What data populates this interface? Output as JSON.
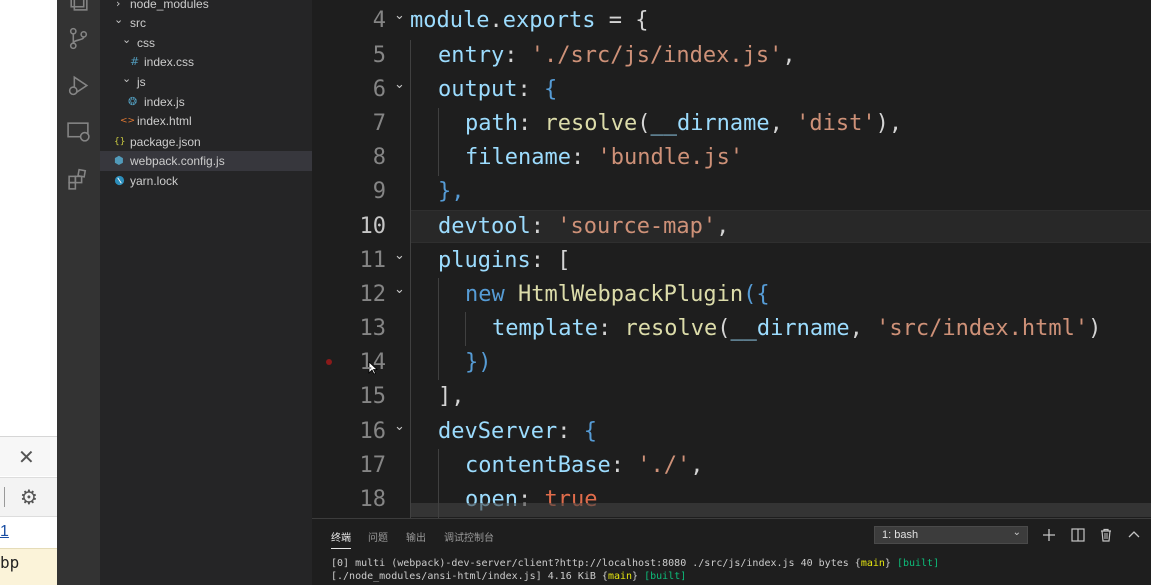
{
  "browser": {
    "close_glyph": "✕",
    "gear_glyph": "⚙",
    "link_text": "1",
    "source_snippet": "bp"
  },
  "activity_bar": {
    "icons": [
      "explorer-icon",
      "source-control-icon",
      "debug-icon",
      "remote-explorer-icon",
      "extensions-icon"
    ]
  },
  "explorer": {
    "items": [
      {
        "label": "node_modules",
        "icon": "chevron-right",
        "depth": 0
      },
      {
        "label": "src",
        "icon": "chevron-down",
        "depth": 0
      },
      {
        "label": "css",
        "icon": "chevron-down",
        "depth": 1
      },
      {
        "label": "index.css",
        "icon": "css-file-icon",
        "depth": 2
      },
      {
        "label": "js",
        "icon": "chevron-down",
        "depth": 1
      },
      {
        "label": "index.js",
        "icon": "js-file-icon",
        "depth": 2
      },
      {
        "label": "index.html",
        "icon": "html-file-icon",
        "depth": 1
      },
      {
        "label": "package.json",
        "icon": "json-file-icon",
        "depth": 0
      },
      {
        "label": "webpack.config.js",
        "icon": "webpack-file-icon",
        "depth": 0,
        "selected": true
      },
      {
        "label": "yarn.lock",
        "icon": "yarn-file-icon",
        "depth": 0
      }
    ],
    "glyphs": {
      "chevron_right": "›",
      "chevron_down": "⌄",
      "css": "#",
      "js": "❂",
      "html": "<>",
      "json": "{}",
      "webpack": "⬢",
      "yarn": "🧶"
    }
  },
  "editor": {
    "line_numbers": [
      "4",
      "5",
      "6",
      "7",
      "8",
      "9",
      "10",
      "11",
      "12",
      "13",
      "14",
      "15",
      "16",
      "17",
      "18"
    ],
    "current_line": "10",
    "breakpoint_line": "14",
    "fold_lines": [
      "4",
      "6",
      "11",
      "12",
      "16"
    ],
    "fold_glyph": "⌄",
    "lines": {
      "l4": {
        "a": "module",
        "b": ".",
        "c": "exports",
        "d": " = {"
      },
      "l5": {
        "a": "entry",
        "b": ": ",
        "c": "'./src/js/index.js'",
        "d": ","
      },
      "l6": {
        "a": "output",
        "b": ": ",
        "c": "{"
      },
      "l7": {
        "a": "path",
        "b": ": ",
        "c": "resolve",
        "d": "(",
        "e": "__dirname",
        "f": ", ",
        "g": "'dist'",
        "h": "),"
      },
      "l8": {
        "a": "filename",
        "b": ": ",
        "c": "'bundle.js'"
      },
      "l9": {
        "a": "},"
      },
      "l10": {
        "a": "devtool",
        "b": ": ",
        "c": "'source-map'",
        "d": ","
      },
      "l11": {
        "a": "plugins",
        "b": ": ["
      },
      "l12": {
        "a": "new ",
        "b": "HtmlWebpackPlugin",
        "c": "({"
      },
      "l13": {
        "a": "template",
        "b": ": ",
        "c": "resolve",
        "d": "(",
        "e": "__dirname",
        "f": ", ",
        "g": "'src/index.html'",
        "h": ")"
      },
      "l14": {
        "a": "})"
      },
      "l15": {
        "a": "],"
      },
      "l16": {
        "a": "devServer",
        "b": ": ",
        "c": "{"
      },
      "l17": {
        "a": "contentBase",
        "b": ": ",
        "c": "'./'",
        "d": ","
      },
      "l18": {
        "a": "open",
        "b": ": ",
        "c": "true"
      }
    }
  },
  "panel": {
    "tabs": [
      "终端",
      "问题",
      "输出",
      "调试控制台"
    ],
    "active_tab": "终端",
    "terminal_select": "1: bash",
    "terminal_output": [
      {
        "pre": "[0] multi (webpack)-dev-server/client?http://localhost:8080 ./src/js/index.js 40 bytes {",
        "chunk": "main",
        "mid": "} ",
        "status": "[built]"
      },
      {
        "pre": "[./node_modules/ansi-html/index.js] 4.16 KiB {",
        "chunk": "main",
        "mid": "} ",
        "status": "[built]"
      }
    ]
  }
}
